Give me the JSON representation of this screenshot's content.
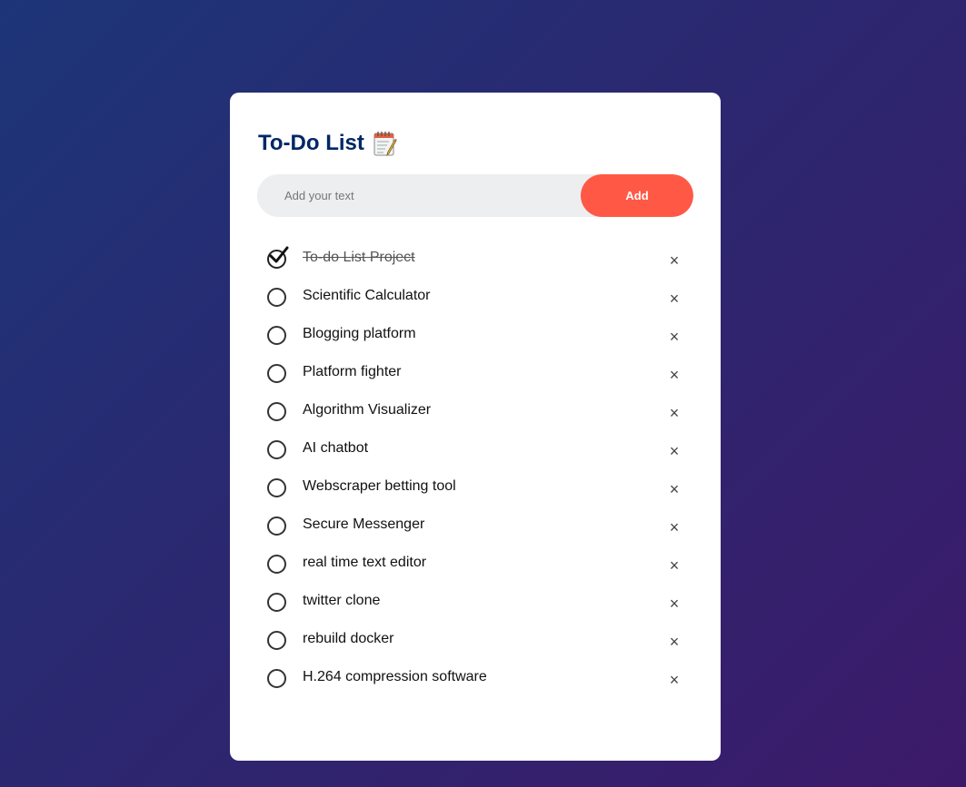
{
  "app": {
    "title": "To-Do List",
    "title_icon": "notepad-icon"
  },
  "input": {
    "placeholder": "Add your text",
    "value": "",
    "add_label": "Add"
  },
  "tasks": [
    {
      "text": "To-do List Project",
      "checked": true
    },
    {
      "text": "Scientific Calculator",
      "checked": false
    },
    {
      "text": "Blogging platform",
      "checked": false
    },
    {
      "text": "Platform fighter",
      "checked": false
    },
    {
      "text": "Algorithm Visualizer",
      "checked": false
    },
    {
      "text": "AI chatbot",
      "checked": false
    },
    {
      "text": "Webscraper betting tool",
      "checked": false
    },
    {
      "text": "Secure Messenger",
      "checked": false
    },
    {
      "text": "real time text editor",
      "checked": false
    },
    {
      "text": "twitter clone",
      "checked": false
    },
    {
      "text": "rebuild docker",
      "checked": false
    },
    {
      "text": "H.264 compression software",
      "checked": false
    }
  ],
  "delete_glyph": "×",
  "colors": {
    "accent": "#ff5945",
    "title": "#002765",
    "input_bg": "#edeef0",
    "background_start": "#1d3578",
    "background_end": "#3c1a6a"
  }
}
